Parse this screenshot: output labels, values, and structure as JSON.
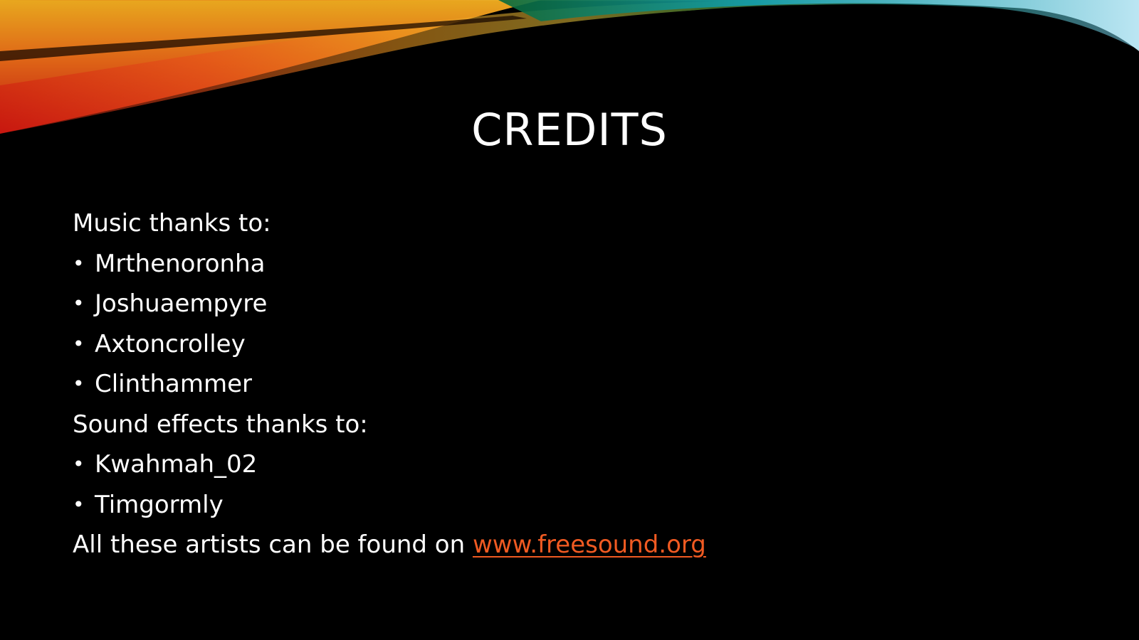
{
  "slide": {
    "title": "CREDITS",
    "music_heading": "Music thanks to:",
    "music_artists": [
      "Mrthenoronha",
      "Joshuaempyre",
      "Axtoncrolley",
      "Clinthammer"
    ],
    "sfx_heading": "Sound effects thanks to:",
    "sfx_artists": [
      "Kwahmah_02",
      "Timgormly"
    ],
    "footer_text": "All these artists can be found on ",
    "footer_link": "www.freesound.org",
    "bullet_glyph": "•"
  },
  "colors": {
    "background": "#000000",
    "text": "#ffffff",
    "link": "#f05a22"
  }
}
